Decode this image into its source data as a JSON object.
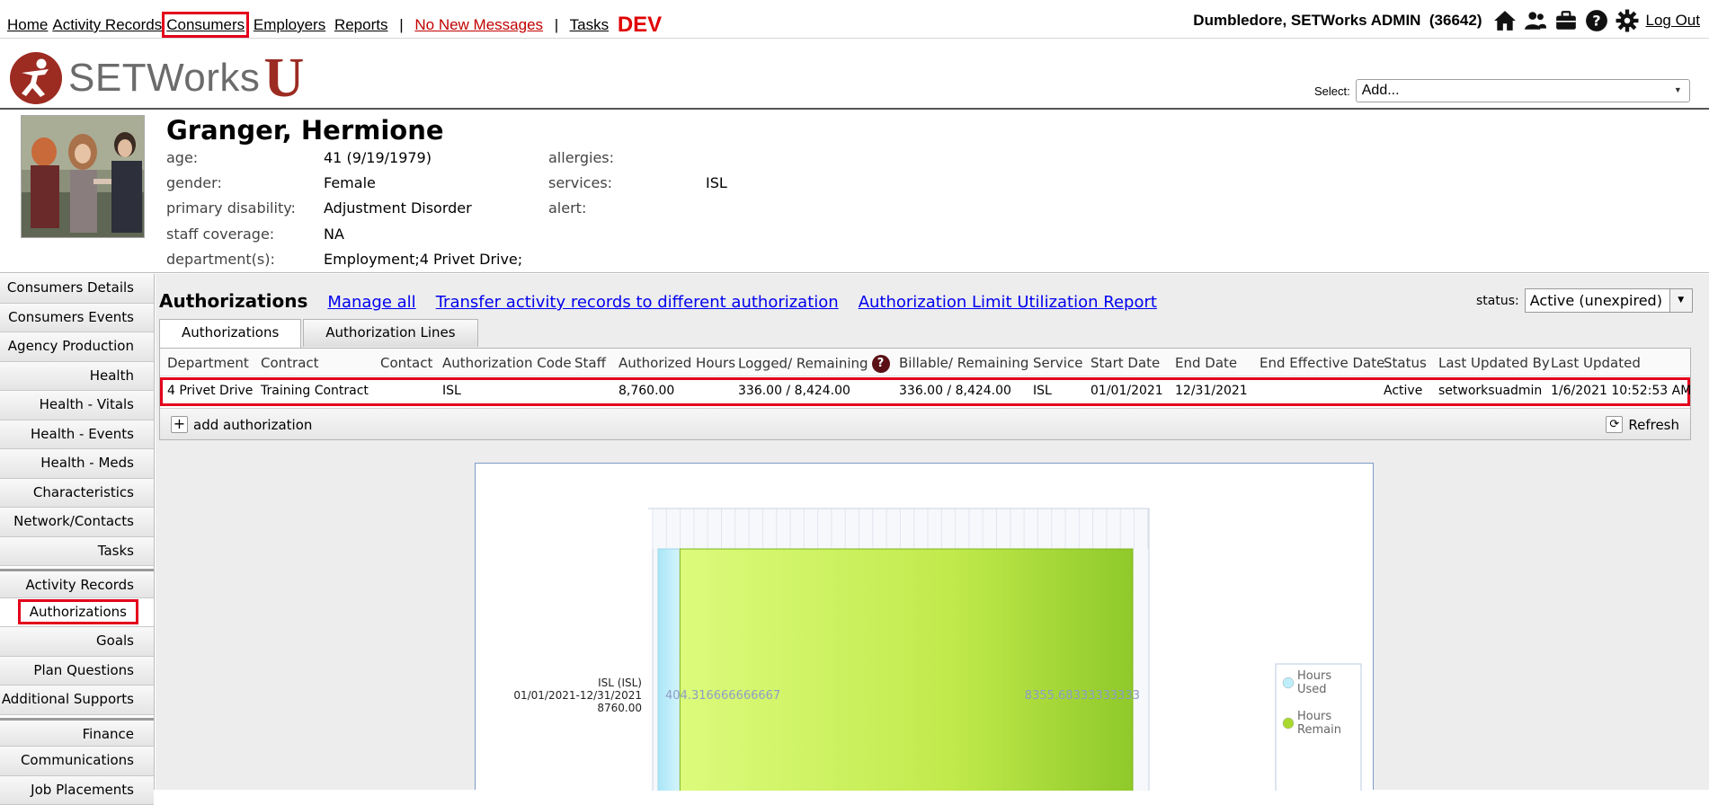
{
  "nav": {
    "links": [
      "Home",
      "Activity Records",
      "Consumers",
      "Employers",
      "Reports"
    ],
    "sep": "|",
    "messages": "No New Messages",
    "tasks": "Tasks",
    "dev": "DEV"
  },
  "user": {
    "name": "Dumbledore, SETWorks ADMIN",
    "id": "(36642)",
    "logout": "Log Out",
    "icons": [
      "home-icon",
      "people-icon",
      "briefcase-icon",
      "help-icon",
      "gear-icon"
    ]
  },
  "logo": {
    "wordmark": "SETWorks",
    "u": "U"
  },
  "select": {
    "label": "Select:",
    "value": "Add..."
  },
  "consumer": {
    "name": "Granger, Hermione",
    "fields_left": [
      {
        "label": "age:",
        "value": "41 (9/19/1979)"
      },
      {
        "label": "gender:",
        "value": "Female"
      },
      {
        "label": "primary disability:",
        "value": "Adjustment Disorder"
      },
      {
        "label": "staff coverage:",
        "value": "NA"
      },
      {
        "label": "department(s):",
        "value": "Employment;4 Privet Drive;"
      }
    ],
    "fields_right": [
      {
        "label": "allergies:",
        "value": ""
      },
      {
        "label": "services:",
        "value": "ISL"
      },
      {
        "label": "alert:",
        "value": ""
      }
    ]
  },
  "sidebar": {
    "items": [
      "Consumers Details",
      "Consumers Events",
      "Agency Production",
      "Health",
      "Health - Vitals",
      "Health - Events",
      "Health - Meds",
      "Characteristics",
      "Network/Contacts",
      "Tasks",
      "Activity Records",
      "Authorizations",
      "Goals",
      "Plan Questions",
      "Additional Supports",
      "Finance",
      "Communications",
      "Job Placements"
    ],
    "active": "Authorizations"
  },
  "main": {
    "title": "Authorizations",
    "links": [
      "Manage all",
      "Transfer activity records to different authorization",
      "Authorization Limit Utilization Report"
    ],
    "status_label": "status:",
    "status_value": "Active (unexpired)",
    "tabs": [
      "Authorizations",
      "Authorization Lines"
    ],
    "columns": [
      "Department",
      "Contract",
      "Contact",
      "Authorization Code",
      "Staff",
      "Authorized Hours",
      "Logged/ Remaining",
      "Billable/ Remaining",
      "Service",
      "Start Date",
      "End Date",
      "End Effective Date",
      "Status",
      "Last Updated By",
      "Last Updated"
    ],
    "help_glyph": "?",
    "rows": [
      [
        "4 Privet Drive",
        "Training Contract",
        "",
        "ISL",
        "",
        "8,760.00",
        "336.00 / 8,424.00",
        "336.00 / 8,424.00",
        "ISL",
        "01/01/2021",
        "12/31/2021",
        "",
        "Active",
        "setworksuadmin",
        "1/6/2021 10:52:53 AM"
      ]
    ],
    "add_label": "add authorization",
    "refresh_label": "Refresh"
  },
  "chart_data": {
    "type": "bar",
    "orientation": "horizontal",
    "stacked": true,
    "categories": [
      "ISL (ISL)\n01/01/2021-12/31/2021\n8760.00"
    ],
    "category_lines": [
      "ISL (ISL)",
      "01/01/2021-12/31/2021",
      "8760.00"
    ],
    "series": [
      {
        "name": "Hours Used",
        "values": [
          404.316666666667
        ],
        "color": "#bdeefa"
      },
      {
        "name": "Hours Remain",
        "values": [
          8355.68333333333
        ],
        "color": "#a9d82f"
      }
    ],
    "data_labels": [
      "404.316666666667",
      "8355.68333333333"
    ],
    "xlim": [
      0,
      8760
    ],
    "legend_position": "right",
    "grid": true
  }
}
